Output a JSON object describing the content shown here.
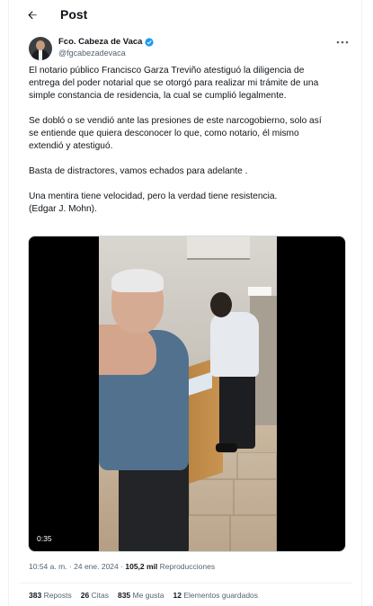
{
  "header": {
    "back_icon": "arrow-left-icon",
    "title": "Post"
  },
  "author": {
    "name": "Fco. Cabeza de Vaca",
    "handle": "@fgcabezadevaca",
    "verified_icon": "verified-badge-icon",
    "more_icon": "more-horizontal-icon"
  },
  "tweet": {
    "paragraph_1": [
      "El notario público Francisco Garza Treviño atestiguó la diligencia de",
      "entrega del poder notarial que se otorgó para realizar mi trámite de una",
      "simple constancia de residencia, la cual se cumplió legalmente."
    ],
    "paragraph_2": [
      "Se dobló o se vendió ante las presiones de este narcogobierno, solo así",
      "se entiende que quiera desconocer lo que, como notario, él mismo",
      "extendió y atestiguó."
    ],
    "paragraph_3": [
      "Basta de distractores, vamos echados para adelante ."
    ],
    "paragraph_4": [
      "Una mentira tiene velocidad, pero la verdad tiene resistencia.",
      "(Edgar J. Mohn)."
    ]
  },
  "media": {
    "duration": "0:35"
  },
  "meta": {
    "time": "10:54 a. m.",
    "separator": "·",
    "date": "24 ene. 2024",
    "views_count": "105,2 mil",
    "views_label": "Reproducciones"
  },
  "stats": {
    "reposts_count": "383",
    "reposts_label": "Reposts",
    "quotes_count": "26",
    "quotes_label": "Citas",
    "likes_count": "835",
    "likes_label": "Me gusta",
    "bookmarks_count": "12",
    "bookmarks_label": "Elementos guardados"
  },
  "colors": {
    "text": "#0f1419",
    "secondary": "#536471",
    "verified": "#1d9bf0",
    "divider": "#eff3f4"
  }
}
